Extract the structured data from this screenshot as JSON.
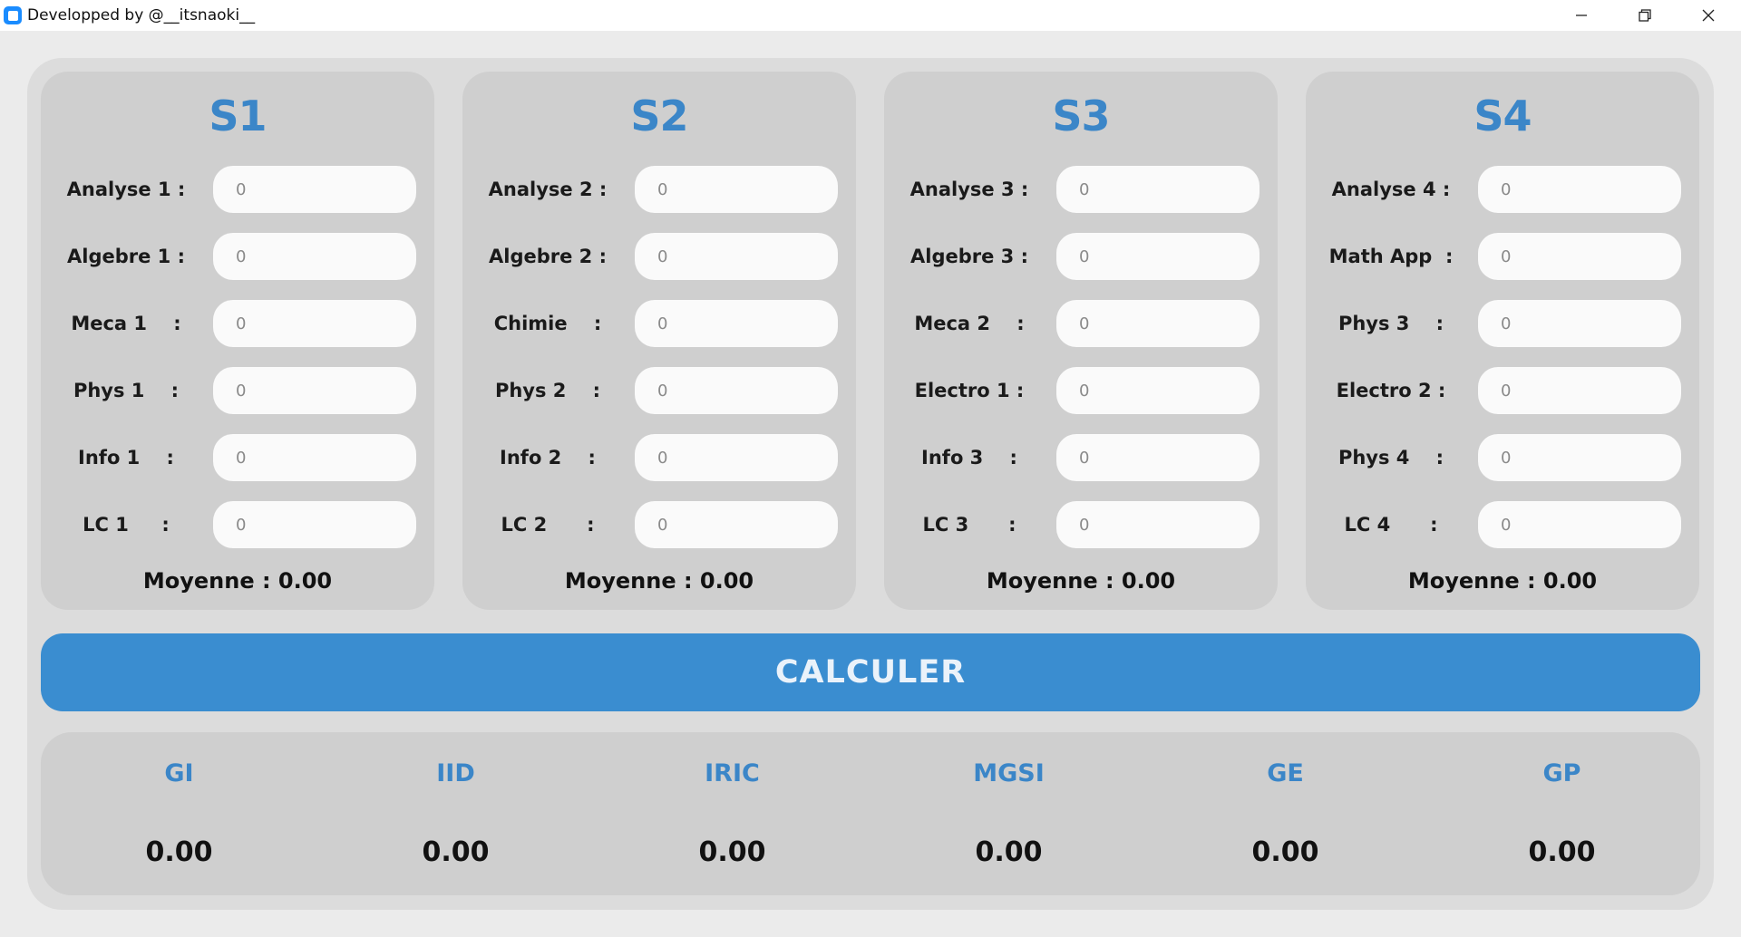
{
  "window": {
    "title": "Developped by @__itsnaoki__"
  },
  "semesters": [
    {
      "title": "S1",
      "subjects": [
        {
          "label": "Analyse 1 :",
          "value": "",
          "placeholder": "0"
        },
        {
          "label": "Algebre 1 :",
          "value": "",
          "placeholder": "0"
        },
        {
          "label": "Meca 1    :",
          "value": "",
          "placeholder": "0"
        },
        {
          "label": "Phys 1    :",
          "value": "",
          "placeholder": "0"
        },
        {
          "label": "Info 1    :",
          "value": "",
          "placeholder": "0"
        },
        {
          "label": "LC 1     :",
          "value": "",
          "placeholder": "0"
        }
      ],
      "average": "Moyenne : 0.00"
    },
    {
      "title": "S2",
      "subjects": [
        {
          "label": "Analyse 2 :",
          "value": "",
          "placeholder": "0"
        },
        {
          "label": "Algebre 2 :",
          "value": "",
          "placeholder": "0"
        },
        {
          "label": "Chimie    :",
          "value": "",
          "placeholder": "0"
        },
        {
          "label": "Phys 2    :",
          "value": "",
          "placeholder": "0"
        },
        {
          "label": "Info 2    :",
          "value": "",
          "placeholder": "0"
        },
        {
          "label": "LC 2      :",
          "value": "",
          "placeholder": "0"
        }
      ],
      "average": "Moyenne : 0.00"
    },
    {
      "title": "S3",
      "subjects": [
        {
          "label": "Analyse 3 :",
          "value": "",
          "placeholder": "0"
        },
        {
          "label": "Algebre 3 :",
          "value": "",
          "placeholder": "0"
        },
        {
          "label": "Meca 2    :",
          "value": "",
          "placeholder": "0"
        },
        {
          "label": "Electro 1 :",
          "value": "",
          "placeholder": "0"
        },
        {
          "label": "Info 3    :",
          "value": "",
          "placeholder": "0"
        },
        {
          "label": "LC 3      :",
          "value": "",
          "placeholder": "0"
        }
      ],
      "average": "Moyenne : 0.00"
    },
    {
      "title": "S4",
      "subjects": [
        {
          "label": "Analyse 4 :",
          "value": "",
          "placeholder": "0"
        },
        {
          "label": "Math App  :",
          "value": "",
          "placeholder": "0"
        },
        {
          "label": "Phys 3    :",
          "value": "",
          "placeholder": "0"
        },
        {
          "label": "Electro 2 :",
          "value": "",
          "placeholder": "0"
        },
        {
          "label": "Phys 4    :",
          "value": "",
          "placeholder": "0"
        },
        {
          "label": "LC 4      :",
          "value": "",
          "placeholder": "0"
        }
      ],
      "average": "Moyenne : 0.00"
    }
  ],
  "calculate_button": {
    "label": "CALCULER"
  },
  "results": [
    {
      "name": "GI",
      "value": "0.00"
    },
    {
      "name": "IID",
      "value": "0.00"
    },
    {
      "name": "IRIC",
      "value": "0.00"
    },
    {
      "name": "MGSI",
      "value": "0.00"
    },
    {
      "name": "GE",
      "value": "0.00"
    },
    {
      "name": "GP",
      "value": "0.00"
    }
  ],
  "colors": {
    "accent": "#3a8dd0",
    "panel": "#cfcfcf",
    "outer": "#dcdcdc",
    "input_bg": "#fafafa"
  },
  "icons": {
    "app": "app-icon",
    "minimize": "minimize-icon",
    "restore": "restore-icon",
    "close": "close-icon"
  }
}
